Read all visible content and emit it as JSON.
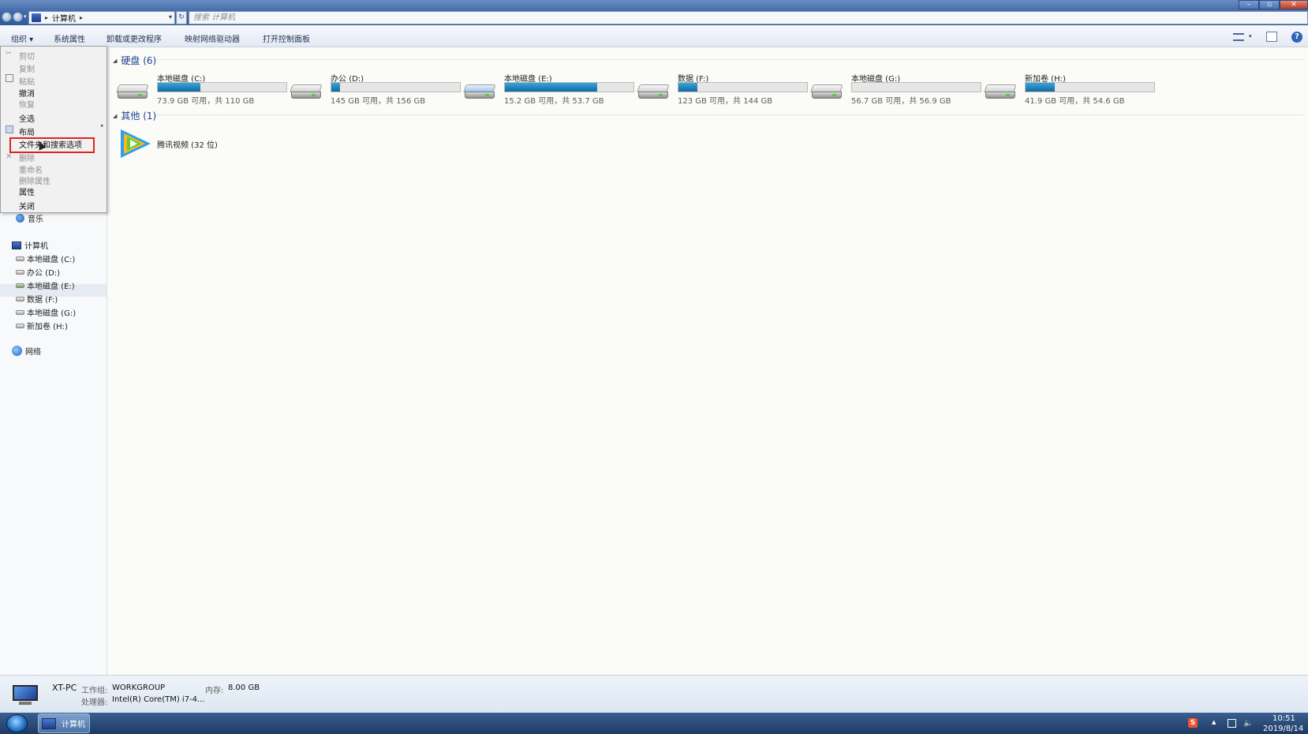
{
  "address": {
    "location": "计算机",
    "search_placeholder": "搜索 计算机"
  },
  "window_controls": {
    "minimize": "–",
    "maximize": "▫",
    "close": "✕"
  },
  "toolbar": {
    "organize": "组织 ▾",
    "system_properties": "系统属性",
    "uninstall": "卸载或更改程序",
    "map_drive": "映射网络驱动器",
    "control_panel": "打开控制面板",
    "help": "?"
  },
  "organize_menu": {
    "items": [
      {
        "label": "剪切",
        "enabled": false
      },
      {
        "label": "复制",
        "enabled": false
      },
      {
        "label": "粘贴",
        "enabled": false
      },
      {
        "label": "撤消",
        "enabled": true
      },
      {
        "label": "恢复",
        "enabled": false
      },
      {
        "label": "全选",
        "enabled": true
      },
      {
        "label": "布局",
        "enabled": true
      },
      {
        "label": "文件夹和搜索选项",
        "enabled": true,
        "highlighted": true
      },
      {
        "label": "删除",
        "enabled": false
      },
      {
        "label": "重命名",
        "enabled": false
      },
      {
        "label": "删除属性",
        "enabled": false
      },
      {
        "label": "属性",
        "enabled": true
      },
      {
        "label": "关闭",
        "enabled": true
      }
    ]
  },
  "navigation": {
    "music": "音乐",
    "computer": "计算机",
    "drives": [
      "本地磁盘 (C:)",
      "办公 (D:)",
      "本地磁盘 (E:)",
      "数据 (F:)",
      "本地磁盘 (G:)",
      "新加卷 (H:)"
    ],
    "network": "网络"
  },
  "groups": {
    "hard_disks": "硬盘 (6)",
    "other": "其他 (1)"
  },
  "drives": [
    {
      "name": "本地磁盘 (C:)",
      "free_text": "73.9 GB 可用，共 110 GB",
      "used_fraction": 0.33
    },
    {
      "name": "办公 (D:)",
      "free_text": "145 GB 可用，共 156 GB",
      "used_fraction": 0.07
    },
    {
      "name": "本地磁盘 (E:)",
      "free_text": "15.2 GB 可用，共 53.7 GB",
      "used_fraction": 0.72
    },
    {
      "name": "数据 (F:)",
      "free_text": "123 GB 可用，共 144 GB",
      "used_fraction": 0.15
    },
    {
      "name": "本地磁盘 (G:)",
      "free_text": "56.7 GB 可用，共 56.9 GB",
      "used_fraction": 0.0
    },
    {
      "name": "新加卷 (H:)",
      "free_text": "41.9 GB 可用，共 54.6 GB",
      "used_fraction": 0.23
    }
  ],
  "other_items": [
    {
      "label": "腾讯视频 (32 位)"
    }
  ],
  "details": {
    "computer_name": "XT-PC",
    "workgroup_label": "工作组:",
    "workgroup": "WORKGROUP",
    "memory_label": "内存:",
    "memory": "8.00 GB",
    "processor_label": "处理器:",
    "processor": "Intel(R) Core(TM) i7-4..."
  },
  "taskbar": {
    "explorer_label": "计算机",
    "time": "10:51",
    "date": "2019/8/14"
  }
}
